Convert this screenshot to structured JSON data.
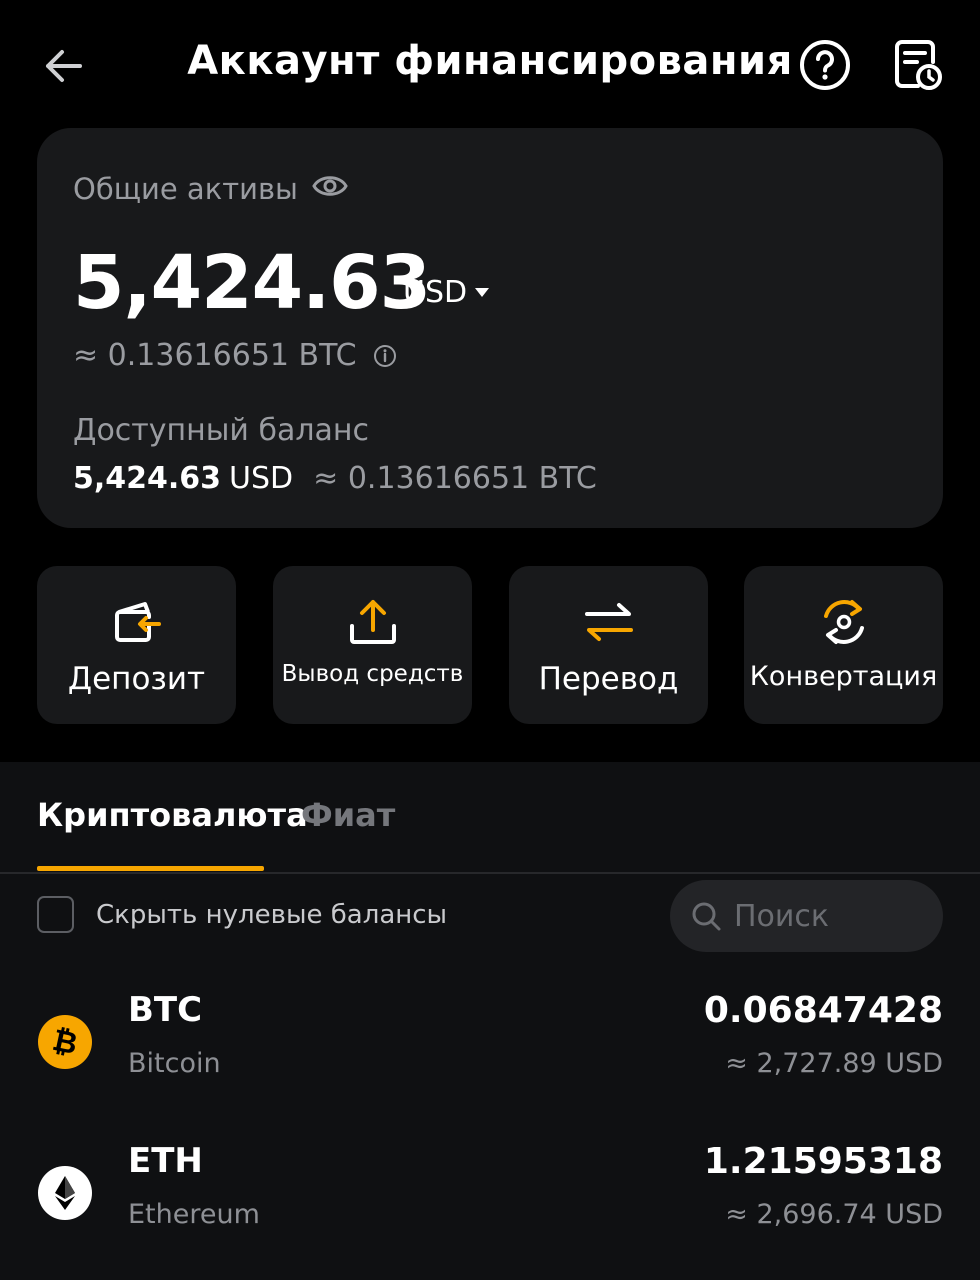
{
  "header": {
    "title": "Аккаунт финансирования",
    "back_icon": "arrow-left-icon",
    "help_icon": "question-circle-icon",
    "history_icon": "document-clock-icon"
  },
  "summary": {
    "total_label": "Общие активы",
    "total_value": "5,424.63",
    "currency": "USD",
    "btc_equivalent": "≈ 0.13616651 BTC",
    "available_label": "Доступный баланс",
    "available_amount": "5,424.63",
    "available_currency": "USD",
    "available_btc": "≈ 0.13616651 BTC"
  },
  "actions": [
    {
      "label": "Депозит",
      "icon": "wallet-deposit-icon"
    },
    {
      "label": "Вывод средств",
      "icon": "upload-icon"
    },
    {
      "label": "Перевод",
      "icon": "transfer-arrows-icon"
    },
    {
      "label": "Конвертация",
      "icon": "convert-icon"
    }
  ],
  "tabs": [
    {
      "label": "Криптовалюта",
      "active": true
    },
    {
      "label": "Фиат",
      "active": false
    }
  ],
  "filters": {
    "hide_zero_label": "Скрыть нулевые балансы",
    "hide_zero_checked": false,
    "search_placeholder": "Поиск",
    "search_value": ""
  },
  "assets": [
    {
      "symbol": "BTC",
      "name": "Bitcoin",
      "amount": "0.06847428",
      "usd": "≈ 2,727.89 USD",
      "icon": "bitcoin-icon"
    },
    {
      "symbol": "ETH",
      "name": "Ethereum",
      "amount": "1.21595318",
      "usd": "≈ 2,696.74 USD",
      "icon": "ethereum-icon"
    }
  ],
  "colors": {
    "accent": "#f7a600",
    "background": "#000000",
    "card": "#18191b",
    "muted_text": "#9a9ca1"
  }
}
